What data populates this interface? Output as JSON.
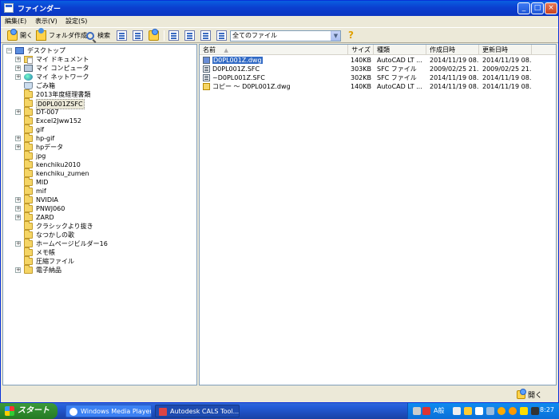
{
  "window": {
    "title": "ファインダー",
    "controls": {
      "minimize": "_",
      "maximize": "□",
      "close": "×"
    }
  },
  "menu": [
    "編集(E)",
    "表示(V)",
    "設定(S)"
  ],
  "toolbar": {
    "open_label": "開く",
    "mkdir_label": "フォルダ作成",
    "search_label": "検索",
    "filter_value": "全てのファイル",
    "help_glyph": "?"
  },
  "tree": {
    "items": [
      {
        "label": "デスクトップ",
        "level": 0,
        "expander": "minus",
        "icon": "desktop"
      },
      {
        "label": "マイ ドキュメント",
        "level": 1,
        "expander": "plus",
        "icon": "docs"
      },
      {
        "label": "マイ コンピュータ",
        "level": 1,
        "expander": "plus",
        "icon": "computer"
      },
      {
        "label": "マイ ネットワーク",
        "level": 1,
        "expander": "plus",
        "icon": "network"
      },
      {
        "label": "ごみ箱",
        "level": 1,
        "expander": "",
        "icon": "trash"
      },
      {
        "label": "2013年度経理書類",
        "level": 1,
        "expander": "",
        "icon": "folder"
      },
      {
        "label": "D0PL001ZSFC",
        "level": 1,
        "expander": "",
        "icon": "folder",
        "selected": true
      },
      {
        "label": "DT-007",
        "level": 1,
        "expander": "plus",
        "icon": "folder"
      },
      {
        "label": "Excel2Jww152",
        "level": 1,
        "expander": "",
        "icon": "folder"
      },
      {
        "label": "gif",
        "level": 1,
        "expander": "",
        "icon": "folder"
      },
      {
        "label": "hp-gif",
        "level": 1,
        "expander": "plus",
        "icon": "folder"
      },
      {
        "label": "hpデータ",
        "level": 1,
        "expander": "plus",
        "icon": "folder"
      },
      {
        "label": "jpg",
        "level": 1,
        "expander": "",
        "icon": "folder"
      },
      {
        "label": "kenchiku2010",
        "level": 1,
        "expander": "",
        "icon": "folder"
      },
      {
        "label": "kenchiku_zumen",
        "level": 1,
        "expander": "",
        "icon": "folder"
      },
      {
        "label": "MID",
        "level": 1,
        "expander": "",
        "icon": "folder"
      },
      {
        "label": "mif",
        "level": 1,
        "expander": "",
        "icon": "folder"
      },
      {
        "label": "NVIDIA",
        "level": 1,
        "expander": "plus",
        "icon": "folder"
      },
      {
        "label": "PNWJ060",
        "level": 1,
        "expander": "plus",
        "icon": "folder"
      },
      {
        "label": "ZARD",
        "level": 1,
        "expander": "plus",
        "icon": "folder"
      },
      {
        "label": "クラシックより抜き",
        "level": 1,
        "expander": "",
        "icon": "folder"
      },
      {
        "label": "なつかしの歌",
        "level": 1,
        "expander": "",
        "icon": "folder"
      },
      {
        "label": "ホームページビルダー16",
        "level": 1,
        "expander": "plus",
        "icon": "folder"
      },
      {
        "label": "メモ帳",
        "level": 1,
        "expander": "",
        "icon": "folder"
      },
      {
        "label": "圧縮ファイル",
        "level": 1,
        "expander": "",
        "icon": "folder"
      },
      {
        "label": "電子納品",
        "level": 1,
        "expander": "plus",
        "icon": "folder"
      }
    ]
  },
  "list": {
    "columns": [
      "名前",
      "サイズ",
      "種類",
      "作成日時",
      "更新日時"
    ],
    "rows": [
      {
        "name": "D0PL001Z.dwg",
        "size": "140KB",
        "type": "AutoCAD LT ...",
        "created": "2014/11/19 08...",
        "modified": "2014/11/19 08...",
        "icon": "dwg",
        "selected": true
      },
      {
        "name": "D0PL001Z.SFC",
        "size": "303KB",
        "type": "SFC ファイル",
        "created": "2009/02/25 21...",
        "modified": "2009/02/25 21...",
        "icon": "sfc"
      },
      {
        "name": "~D0PL001Z.SFC",
        "size": "302KB",
        "type": "SFC ファイル",
        "created": "2014/11/19 08...",
        "modified": "2014/11/19 08...",
        "icon": "sfc"
      },
      {
        "name": "コピー ～ D0PL001Z.dwg",
        "size": "140KB",
        "type": "AutoCAD LT ...",
        "created": "2014/11/19 08...",
        "modified": "2014/11/19 08...",
        "icon": "copy"
      }
    ]
  },
  "bottom": {
    "open_label": "開く"
  },
  "taskbar": {
    "start_label": "スタート",
    "tasks": [
      "Windows Media Player",
      "Autodesk CALS Tool..."
    ],
    "tray_text": "A般",
    "clock": "8:27"
  }
}
